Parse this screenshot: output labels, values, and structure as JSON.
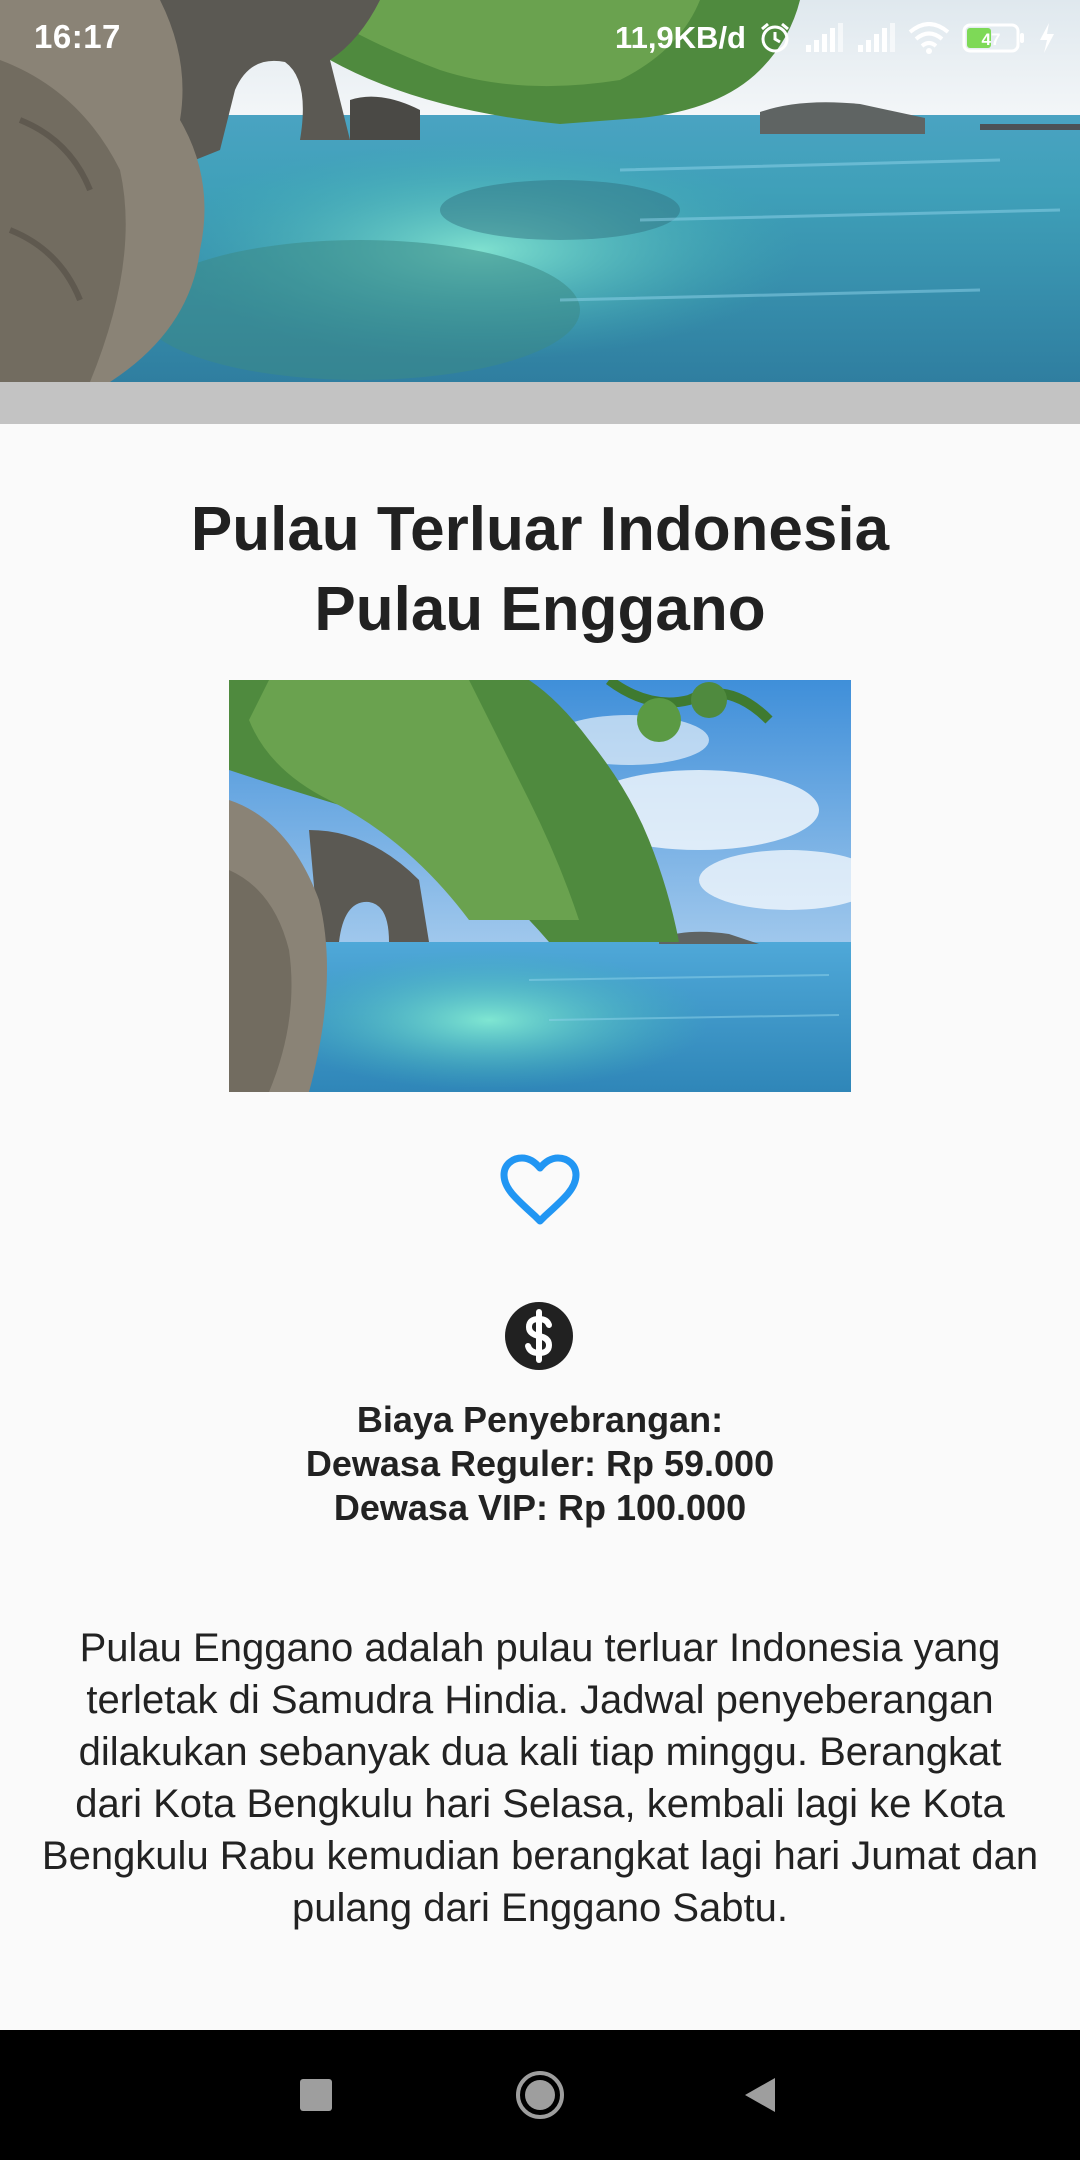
{
  "status_bar": {
    "time": "16:17",
    "network_speed": "11,9KB/d",
    "battery_level": "47",
    "icons": [
      "alarm-icon",
      "signal-icon",
      "signal-icon",
      "wifi-icon",
      "battery-icon",
      "charging-icon"
    ]
  },
  "header": {
    "image": "island-rock-arch-beach-photo"
  },
  "main": {
    "title_line1": "Pulau Terluar Indonesia",
    "title_line2": "Pulau Enggano",
    "image": "island-rock-arch-beach-photo",
    "favorite_icon": "heart-outline-icon",
    "favorite_color": "#2196f3",
    "price_icon": "dollar-circle-icon",
    "cost_heading": "Biaya Penyebrangan:",
    "cost_regular": "Dewasa Reguler: Rp 59.000",
    "cost_vip": "Dewasa VIP: Rp 100.000",
    "description": "Pulau Enggano adalah pulau terluar Indonesia yang terletak di Samudra Hindia. Jadwal penyeberangan dilakukan sebanyak dua kali tiap minggu. Berangkat dari Kota Bengkulu hari Selasa, kembali lagi ke Kota Bengkulu Rabu kemudian berangkat lagi hari Jumat dan pulang dari Enggano Sabtu."
  },
  "nav_bar": {
    "buttons": [
      "recents-square-icon",
      "home-circle-icon",
      "back-triangle-icon"
    ]
  }
}
